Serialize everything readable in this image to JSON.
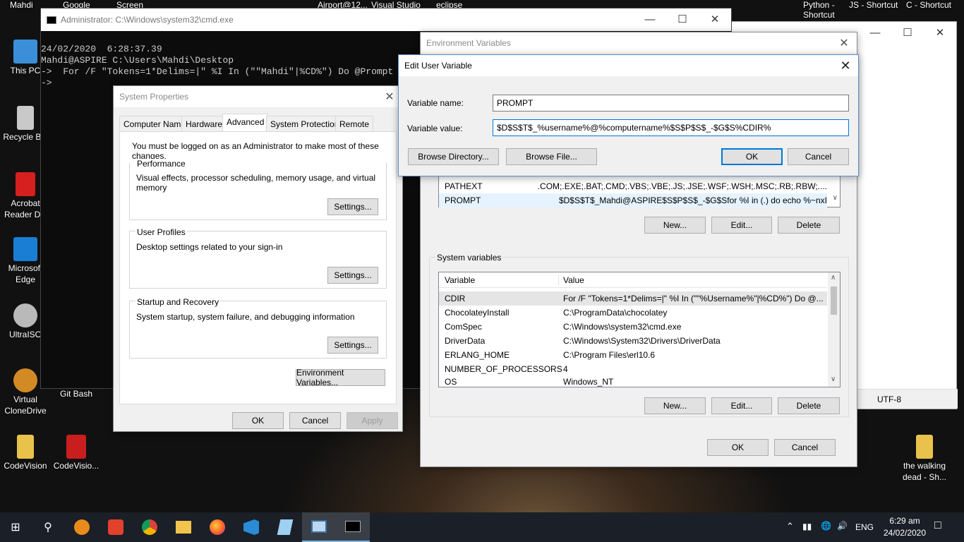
{
  "top_labels": [
    "Mahdi",
    "Google",
    "Screen",
    "Airport@12...",
    "Visual Studio",
    "eclipse",
    "Python -\nShortcut",
    "JS - Shortcut",
    "C - Shortcut"
  ],
  "desktop_icons": [
    {
      "label": "This PC",
      "icon": "computer-icon",
      "color": "#3a8fd8"
    },
    {
      "label": "Recycle Bin",
      "icon": "recycle-bin-icon",
      "color": "#c9c9c9"
    },
    {
      "label": "Acrobat Reader DC",
      "icon": "acrobat-icon",
      "color": "#d61f1f"
    },
    {
      "label": "Microsoft Edge",
      "icon": "edge-icon",
      "color": "#1a7ed4"
    },
    {
      "label": "UltraISO",
      "icon": "disc-icon",
      "color": "#b9b9b9"
    },
    {
      "label": "Virtual CloneDrive",
      "icon": "sheep-icon",
      "color": "#d28a25"
    },
    {
      "label": "CodeVision",
      "icon": "folder-icon",
      "color": "#e8c24a"
    },
    {
      "label": "Git Bash",
      "icon": "git-icon",
      "color": "#333333"
    },
    {
      "label": "CodeVisio...",
      "icon": "cv-icon",
      "color": "#c81e1e"
    },
    {
      "label": "the walking dead - Sh...",
      "icon": "folder-icon",
      "color": "#e8c24a"
    }
  ],
  "cmd": {
    "title": "Administrator: C:\\Windows\\system32\\cmd.exe",
    "lines": [
      "24/02/2020  6:28:37.39",
      "Mahdi@ASPIRE C:\\Users\\Mahdi\\Desktop",
      "->  For /F \"Tokens=1*Delims=|\" %I In (\"\"Mahdi\"|%CD%\") Do @Prompt",
      "->"
    ]
  },
  "notepad": {
    "status_encoding": "UTF-8"
  },
  "system_properties": {
    "title": "System Properties",
    "tabs": [
      "Computer Name",
      "Hardware",
      "Advanced",
      "System Protection",
      "Remote"
    ],
    "selected_tab": "Advanced",
    "admin_note": "You must be logged on as an Administrator to make most of these changes.",
    "groups": [
      {
        "label": "Performance",
        "desc": "Visual effects, processor scheduling, memory usage, and virtual memory",
        "button": "Settings..."
      },
      {
        "label": "User Profiles",
        "desc": "Desktop settings related to your sign-in",
        "button": "Settings..."
      },
      {
        "label": "Startup and Recovery",
        "desc": "System startup, system failure, and debugging information",
        "button": "Settings..."
      }
    ],
    "env_button": "Environment Variables...",
    "ok": "OK",
    "cancel": "Cancel",
    "apply": "Apply"
  },
  "env_vars": {
    "title": "Environment Variables",
    "user_rows": [
      {
        "name": "PATHEXT",
        "value": ".COM;.EXE;.BAT;.CMD;.VBS;.VBE;.JS;.JSE;.WSF;.WSH;.MSC;.RB;.RBW;...."
      },
      {
        "name": "PROMPT",
        "value": "$D$S$T$_Mahdi@ASPIRE$S$P$S$_-$G$Sfor %I in (.) do echo %~nxI"
      }
    ],
    "user_buttons": [
      "New...",
      "Edit...",
      "Delete"
    ],
    "system_label": "System variables",
    "col_variable": "Variable",
    "col_value": "Value",
    "system_rows": [
      {
        "name": "CDIR",
        "value": "For /F \"Tokens=1*Delims=|\" %I In (\"\"%Username%\"|%CD%\") Do @..."
      },
      {
        "name": "ChocolateyInstall",
        "value": "C:\\ProgramData\\chocolatey"
      },
      {
        "name": "ComSpec",
        "value": "C:\\Windows\\system32\\cmd.exe"
      },
      {
        "name": "DriverData",
        "value": "C:\\Windows\\System32\\Drivers\\DriverData"
      },
      {
        "name": "ERLANG_HOME",
        "value": "C:\\Program Files\\erl10.6"
      },
      {
        "name": "NUMBER_OF_PROCESSORS",
        "value": "4"
      },
      {
        "name": "OS",
        "value": "Windows_NT"
      }
    ],
    "system_buttons": [
      "New...",
      "Edit...",
      "Delete"
    ],
    "ok": "OK",
    "cancel": "Cancel"
  },
  "edit_var": {
    "title": "Edit User Variable",
    "name_label": "Variable name:",
    "name_value": "PROMPT",
    "value_label": "Variable value:",
    "value_value": "$D$S$T$_%username%@%computername%$S$P$S$_-$G$S%CDIR%",
    "browse_dir": "Browse Directory...",
    "browse_file": "Browse File...",
    "ok": "OK",
    "cancel": "Cancel"
  },
  "taskbar": {
    "items": [
      {
        "icon": "windows-start-icon"
      },
      {
        "icon": "search-icon"
      },
      {
        "icon": "app-orange-icon"
      },
      {
        "icon": "app-red-icon"
      },
      {
        "icon": "chrome-icon"
      },
      {
        "icon": "file-explorer-icon"
      },
      {
        "icon": "firefox-icon"
      },
      {
        "icon": "vscode-icon"
      },
      {
        "icon": "notepad-icon"
      },
      {
        "icon": "system-properties-icon"
      },
      {
        "icon": "cmd-icon"
      }
    ],
    "lang": "ENG",
    "time": "6:29 am",
    "date": "24/02/2020"
  }
}
